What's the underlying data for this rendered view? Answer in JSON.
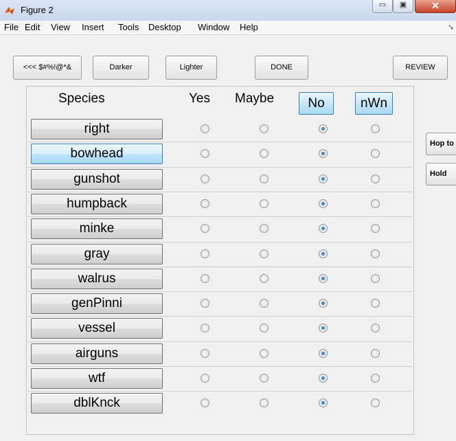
{
  "window": {
    "title": "Figure 2"
  },
  "menu": [
    "File",
    "Edit",
    "View",
    "Insert",
    "Tools",
    "Desktop",
    "Window",
    "Help"
  ],
  "toolbar": {
    "back_label": "<<< $#%!@*&",
    "darker_label": "Darker",
    "lighter_label": "Lighter",
    "done_label": "DONE",
    "review_label": "REVIEW"
  },
  "headers": {
    "species": "Species",
    "yes": "Yes",
    "maybe": "Maybe",
    "no": "No",
    "nwn": "nWn"
  },
  "side": {
    "hop_label": "Hop to",
    "hold_label": "Hold"
  },
  "rows": [
    {
      "species": "right",
      "selected": "No"
    },
    {
      "species": "bowhead",
      "selected": "No",
      "highlighted": true
    },
    {
      "species": "gunshot",
      "selected": "No"
    },
    {
      "species": "humpback",
      "selected": "No"
    },
    {
      "species": "minke",
      "selected": "No"
    },
    {
      "species": "gray",
      "selected": "No"
    },
    {
      "species": "walrus",
      "selected": "No"
    },
    {
      "species": "genPinni",
      "selected": "No"
    },
    {
      "species": "vessel",
      "selected": "No"
    },
    {
      "species": "airguns",
      "selected": "No"
    },
    {
      "species": "wtf",
      "selected": "No"
    },
    {
      "species": "dblKnck",
      "selected": "No"
    }
  ],
  "colors": {
    "selected_accent": "#a7d9f5",
    "window_bg": "#f0f0f0"
  }
}
